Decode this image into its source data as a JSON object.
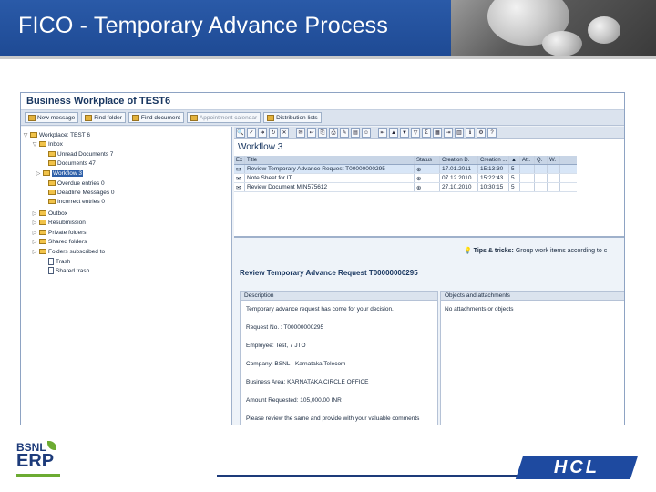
{
  "slide": {
    "title": "FICO - Temporary Advance Process",
    "colors": {
      "header": "#1e4a94",
      "hcl": "#1e4aa0",
      "bsnl_green": "#6cab32"
    }
  },
  "sap": {
    "window_title": "Business Workplace of TEST6",
    "toolbar": [
      {
        "label": "New message",
        "enabled": true
      },
      {
        "label": "Find folder",
        "enabled": true
      },
      {
        "label": "Find document",
        "enabled": true
      },
      {
        "label": "Appointment calendar",
        "enabled": false
      },
      {
        "label": "Distribution lists",
        "enabled": true
      }
    ],
    "tree": [
      {
        "label": "Workplace: TEST 6",
        "expander": "▽",
        "icon": "folder"
      },
      {
        "label": "Inbox",
        "expander": "▽",
        "icon": "folder"
      },
      {
        "label": "Unread Documents 7",
        "expander": "",
        "icon": "folder"
      },
      {
        "label": "Documents 47",
        "expander": "",
        "icon": "folder"
      },
      {
        "label": "Workflow 3",
        "expander": "▷",
        "icon": "folder",
        "selected": true
      },
      {
        "label": "Overdue entries 0",
        "expander": "",
        "icon": "folder"
      },
      {
        "label": "Deadline Messages 0",
        "expander": "",
        "icon": "folder"
      },
      {
        "label": "Incorrect entries 0",
        "expander": "",
        "icon": "folder"
      },
      {
        "label": "Outbox",
        "expander": "▷",
        "icon": "folder"
      },
      {
        "label": "Resubmission",
        "expander": "▷",
        "icon": "folder"
      },
      {
        "label": "Private folders",
        "expander": "▷",
        "icon": "folder"
      },
      {
        "label": "Shared folders",
        "expander": "▷",
        "icon": "folder"
      },
      {
        "label": "Folders subscribed to",
        "expander": "▷",
        "icon": "folder"
      },
      {
        "label": "Trash",
        "expander": "",
        "icon": "doc"
      },
      {
        "label": "Shared trash",
        "expander": "",
        "icon": "doc"
      }
    ],
    "workflow_title": "Workflow 3",
    "grid": {
      "columns": [
        "Ex",
        "Title",
        "Status",
        "Creation D.",
        "Creation ...",
        "▲",
        "Att.",
        "Q.",
        "W."
      ],
      "rows": [
        {
          "title": "Review Temporary Advance Request T00000000295",
          "date": "17.01.2011",
          "time": "15:13:30",
          "att": "5"
        },
        {
          "title": "Note Sheet for IT",
          "date": "07.12.2010",
          "time": "15:22:43",
          "att": "5"
        },
        {
          "title": "Review Document MIN575612",
          "date": "27.10.2010",
          "time": "10:30:15",
          "att": "5"
        }
      ]
    },
    "tips": {
      "label": "Tips & tricks:",
      "text": "Group work items according to c"
    },
    "request_title": "Review Temporary Advance Request T00000000295",
    "description": {
      "header": "Description",
      "lines": [
        "Temporary advance request has come for your decision.",
        "Request No. : T00000000295",
        "Employee: Test, 7 JTO",
        "Company: BSNL - Karnataka Telecom",
        "Business Area: KARNATAKA CIRCLE OFFICE",
        "Amount Requested: 105,000.00 INR",
        "Please review the same and provide with your valuable comments"
      ]
    },
    "attachments": {
      "header": "Objects and attachments",
      "text": "No attachments or objects"
    }
  },
  "footer": {
    "bsnl": "BSNL",
    "erp": "ERP",
    "hcl": "HCL"
  }
}
